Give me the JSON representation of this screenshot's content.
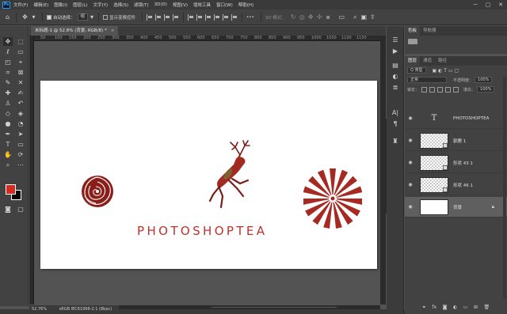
{
  "app": {
    "logo": "Ps"
  },
  "menu": [
    "文件(F)",
    "编辑(E)",
    "图像(I)",
    "图层(L)",
    "文字(Y)",
    "选择(S)",
    "滤镜(T)",
    "3D(D)",
    "视图(V)",
    "增效工具",
    "窗口(W)",
    "帮助(H)"
  ],
  "window_controls": {
    "minimize": "─",
    "maximize": "▢",
    "close": "✕"
  },
  "options": {
    "home_icon": "⌂",
    "move_icon": "✥",
    "auto_select_label": "自动选择：",
    "auto_select_value": "组",
    "show_transform_label": "显示变换控件",
    "more": "•••",
    "mode_3d_label": "3D 模式："
  },
  "document": {
    "tab_title": "未标题-1 @ 52.8% (背景, RGB/8) *",
    "close": "×",
    "ruler_marks": [
      "50",
      "100",
      "150",
      "200",
      "250",
      "300",
      "350",
      "400",
      "450",
      "500",
      "550",
      "600",
      "650",
      "700",
      "750",
      "800",
      "850",
      "900",
      "950",
      "1000",
      "1050",
      "1100",
      "1150"
    ],
    "canvas_text": "PHOTOSHOPTEA"
  },
  "status": {
    "zoom": "52.76%",
    "profile": "sRGB IEC61966-2.1 (8bpc)"
  },
  "panels": {
    "top_tabs": [
      "色板",
      "导航器"
    ],
    "layer_tabs": [
      "图层",
      "通道",
      "路径"
    ],
    "filter_select": "Q 类型",
    "blend_mode": "正常",
    "opacity_label": "不透明度：",
    "opacity_value": "100%",
    "lock_label": "锁定：",
    "fill_label": "填充：",
    "fill_value": "100%",
    "layers": [
      {
        "name": "PHOTOSHOPTEA",
        "kind": "text"
      },
      {
        "name": "驯鹿 1",
        "kind": "shape"
      },
      {
        "name": "形状 43 1",
        "kind": "shape"
      },
      {
        "name": "形状 46 1",
        "kind": "shape"
      },
      {
        "name": "背景",
        "kind": "background"
      }
    ],
    "footer_icons": [
      "link-icon",
      "fx-icon",
      "mask-icon",
      "adjustment-icon",
      "group-icon",
      "new-layer-icon",
      "delete-icon"
    ]
  },
  "colors": {
    "foreground": "#d6291f",
    "background": "#000000",
    "accent_red": "#c0302a",
    "dark_red": "#7a1d18"
  }
}
